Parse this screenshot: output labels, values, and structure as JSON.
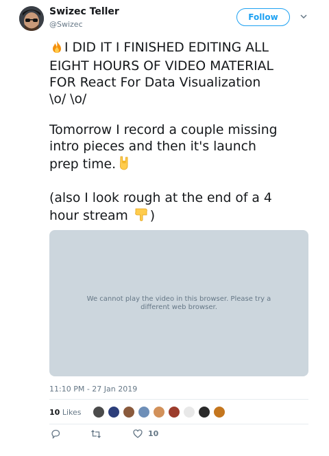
{
  "user": {
    "name": "Swizec Teller",
    "handle": "@Swizec"
  },
  "follow_label": "Follow",
  "tweet": {
    "p1": {
      "emoji": "fire-icon",
      "line1": "I DID IT I FINISHED EDITING ALL",
      "line2": "EIGHT HOURS OF VIDEO MATERIAL",
      "line3": "FOR React For Data Visualization",
      "line4": "\\o/ \\o/"
    },
    "p2": {
      "line1": "Tomorrow I record a couple missing",
      "line2": "intro pieces and then it's launch",
      "line3": "prep time.",
      "emoji": "sign-of-horns-icon"
    },
    "p3": {
      "line1": "(also I look rough at the end of a 4",
      "line2a": "hour stream",
      "emoji": "pointing-down-icon",
      "line2b": ")"
    }
  },
  "video": {
    "message": "We cannot play the video in this browser. Please try a different web browser."
  },
  "timestamp": "11:10 PM - 27 Jan 2019",
  "likes": {
    "count": "10",
    "label": "Likes"
  },
  "actions": {
    "reply_icon": "reply-icon",
    "retweet_icon": "retweet-icon",
    "like_icon": "heart-icon",
    "like_count": "10"
  },
  "colors": {
    "accent": "#1da1f2",
    "secondary_text": "#657786",
    "video_bg": "#ccd6dd"
  }
}
